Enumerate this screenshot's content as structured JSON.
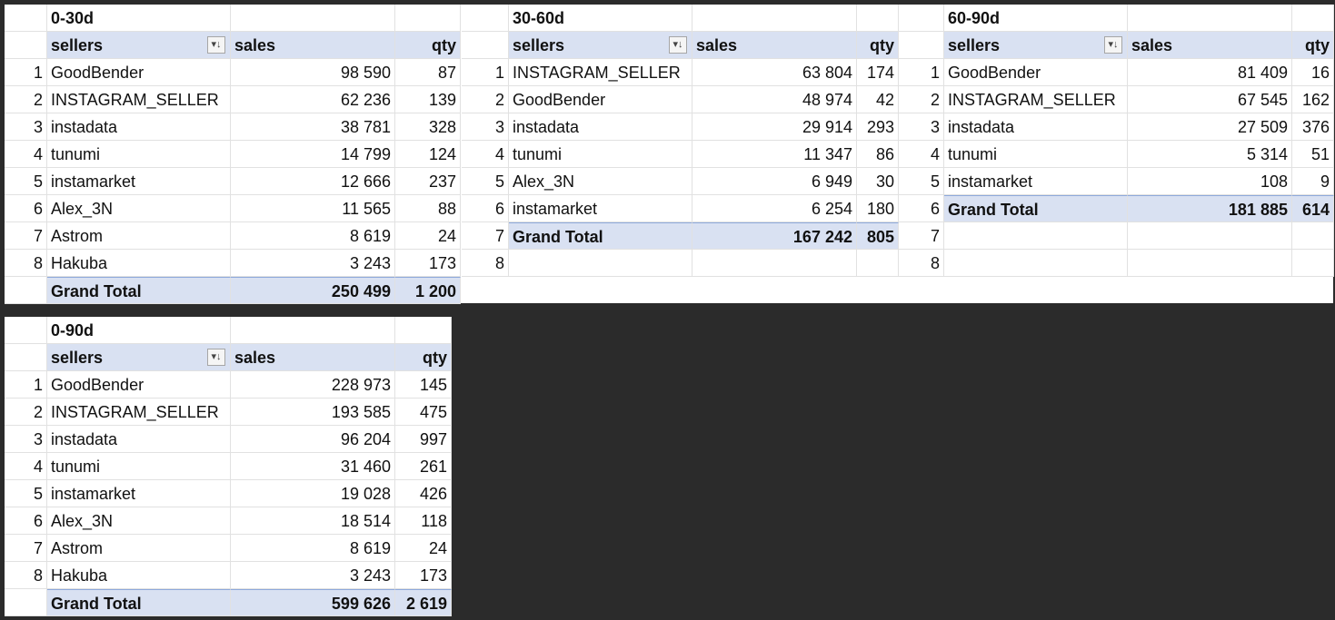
{
  "pivots_top": [
    {
      "title": "0-30d",
      "headers": {
        "sellers": "sellers",
        "sales": "sales",
        "qty": "qty"
      },
      "rows": [
        {
          "idx": "1",
          "name": "GoodBender",
          "sales": "98 590",
          "qty": "87"
        },
        {
          "idx": "2",
          "name": "INSTAGRAM_SELLER",
          "sales": "62 236",
          "qty": "139"
        },
        {
          "idx": "3",
          "name": "instadata",
          "sales": "38 781",
          "qty": "328"
        },
        {
          "idx": "4",
          "name": "tunumi",
          "sales": "14 799",
          "qty": "124"
        },
        {
          "idx": "5",
          "name": "instamarket",
          "sales": "12 666",
          "qty": "237"
        },
        {
          "idx": "6",
          "name": "Alex_3N",
          "sales": "11 565",
          "qty": "88"
        },
        {
          "idx": "7",
          "name": "Astrom",
          "sales": "8 619",
          "qty": "24"
        },
        {
          "idx": "8",
          "name": "Hakuba",
          "sales": "3 243",
          "qty": "173"
        }
      ],
      "total": {
        "label": "Grand Total",
        "sales": "250 499",
        "qty": "1 200"
      }
    },
    {
      "title": "30-60d",
      "headers": {
        "sellers": "sellers",
        "sales": "sales",
        "qty": "qty"
      },
      "rows": [
        {
          "idx": "1",
          "name": "INSTAGRAM_SELLER",
          "sales": "63 804",
          "qty": "174"
        },
        {
          "idx": "2",
          "name": "GoodBender",
          "sales": "48 974",
          "qty": "42"
        },
        {
          "idx": "3",
          "name": "instadata",
          "sales": "29 914",
          "qty": "293"
        },
        {
          "idx": "4",
          "name": "tunumi",
          "sales": "11 347",
          "qty": "86"
        },
        {
          "idx": "5",
          "name": "Alex_3N",
          "sales": "6 949",
          "qty": "30"
        },
        {
          "idx": "6",
          "name": "instamarket",
          "sales": "6 254",
          "qty": "180"
        }
      ],
      "total": {
        "idx": "7",
        "label": "Grand Total",
        "sales": "167 242",
        "qty": "805"
      },
      "extra_idx": [
        "8"
      ]
    },
    {
      "title": "60-90d",
      "headers": {
        "sellers": "sellers",
        "sales": "sales",
        "qty": "qty"
      },
      "rows": [
        {
          "idx": "1",
          "name": "GoodBender",
          "sales": "81 409",
          "qty": "16"
        },
        {
          "idx": "2",
          "name": "INSTAGRAM_SELLER",
          "sales": "67 545",
          "qty": "162"
        },
        {
          "idx": "3",
          "name": "instadata",
          "sales": "27 509",
          "qty": "376"
        },
        {
          "idx": "4",
          "name": "tunumi",
          "sales": "5 314",
          "qty": "51"
        },
        {
          "idx": "5",
          "name": "instamarket",
          "sales": "108",
          "qty": "9"
        }
      ],
      "total": {
        "idx": "6",
        "label": "Grand Total",
        "sales": "181 885",
        "qty": "614"
      },
      "extra_idx": [
        "7",
        "8"
      ]
    }
  ],
  "pivot_bottom": {
    "title": "0-90d",
    "headers": {
      "sellers": "sellers",
      "sales": "sales",
      "qty": "qty"
    },
    "rows": [
      {
        "idx": "1",
        "name": "GoodBender",
        "sales": "228 973",
        "qty": "145"
      },
      {
        "idx": "2",
        "name": "INSTAGRAM_SELLER",
        "sales": "193 585",
        "qty": "475"
      },
      {
        "idx": "3",
        "name": "instadata",
        "sales": "96 204",
        "qty": "997"
      },
      {
        "idx": "4",
        "name": "tunumi",
        "sales": "31 460",
        "qty": "261"
      },
      {
        "idx": "5",
        "name": "instamarket",
        "sales": "19 028",
        "qty": "426"
      },
      {
        "idx": "6",
        "name": "Alex_3N",
        "sales": "18 514",
        "qty": "118"
      },
      {
        "idx": "7",
        "name": "Astrom",
        "sales": "8 619",
        "qty": "24"
      },
      {
        "idx": "8",
        "name": "Hakuba",
        "sales": "3 243",
        "qty": "173"
      }
    ],
    "total": {
      "label": "Grand Total",
      "sales": "599 626",
      "qty": "2 619"
    }
  },
  "filter_icon": "sort-filter-icon",
  "colors": {
    "header_bg": "#d9e1f2",
    "background": "#2b2b2b",
    "grid": "#e1e1e1"
  }
}
